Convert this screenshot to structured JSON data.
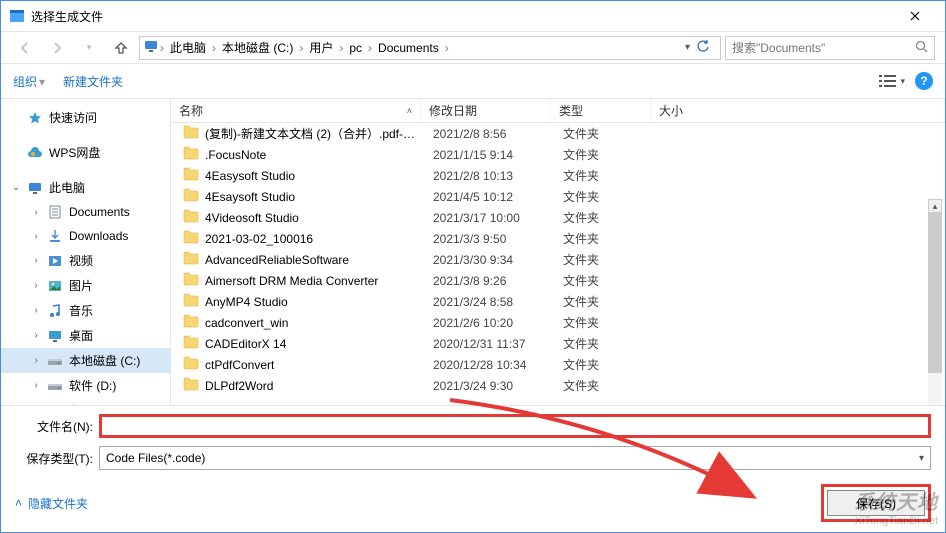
{
  "window": {
    "title": "选择生成文件"
  },
  "breadcrumb": {
    "items": [
      "此电脑",
      "本地磁盘 (C:)",
      "用户",
      "pc",
      "Documents"
    ]
  },
  "search": {
    "placeholder": "搜索\"Documents\""
  },
  "toolbar": {
    "organize": "组织",
    "newfolder": "新建文件夹"
  },
  "sidebar": {
    "quick": "快速访问",
    "wps": "WPS网盘",
    "thispc": "此电脑",
    "children": [
      {
        "label": "Documents"
      },
      {
        "label": "Downloads"
      },
      {
        "label": "视频"
      },
      {
        "label": "图片"
      },
      {
        "label": "音乐"
      },
      {
        "label": "桌面"
      },
      {
        "label": "本地磁盘 (C:)",
        "selected": true
      },
      {
        "label": "软件 (D:)"
      },
      {
        "label": "备份 (E:)"
      }
    ]
  },
  "columns": {
    "name": "名称",
    "date": "修改日期",
    "type": "类型",
    "size": "大小"
  },
  "files": [
    {
      "name": "(复制)-新建文本文档 (2)（合并）.pdf-2...",
      "date": "2021/2/8 8:56",
      "type": "文件夹"
    },
    {
      "name": ".FocusNote",
      "date": "2021/1/15 9:14",
      "type": "文件夹"
    },
    {
      "name": "4Easysoft Studio",
      "date": "2021/2/8 10:13",
      "type": "文件夹"
    },
    {
      "name": "4Esaysoft Studio",
      "date": "2021/4/5 10:12",
      "type": "文件夹"
    },
    {
      "name": "4Videosoft Studio",
      "date": "2021/3/17 10:00",
      "type": "文件夹"
    },
    {
      "name": "2021-03-02_100016",
      "date": "2021/3/3 9:50",
      "type": "文件夹"
    },
    {
      "name": "AdvancedReliableSoftware",
      "date": "2021/3/30 9:34",
      "type": "文件夹"
    },
    {
      "name": "Aimersoft DRM Media Converter",
      "date": "2021/3/8 9:26",
      "type": "文件夹"
    },
    {
      "name": "AnyMP4 Studio",
      "date": "2021/3/24 8:58",
      "type": "文件夹"
    },
    {
      "name": "cadconvert_win",
      "date": "2021/2/6 10:20",
      "type": "文件夹"
    },
    {
      "name": "CADEditorX 14",
      "date": "2020/12/31 11:37",
      "type": "文件夹"
    },
    {
      "name": "ctPdfConvert",
      "date": "2020/12/28 10:34",
      "type": "文件夹"
    },
    {
      "name": "DLPdf2Word",
      "date": "2021/3/24 9:30",
      "type": "文件夹"
    }
  ],
  "form": {
    "filename_label": "文件名(N):",
    "filename_value": "",
    "filetype_label": "保存类型(T):",
    "filetype_value": "Code Files(*.code)"
  },
  "footer": {
    "hide_folders": "隐藏文件夹",
    "save": "保存(S)"
  },
  "watermark": {
    "line1": "系统天地",
    "line2": "XiTongTianDi.net"
  }
}
